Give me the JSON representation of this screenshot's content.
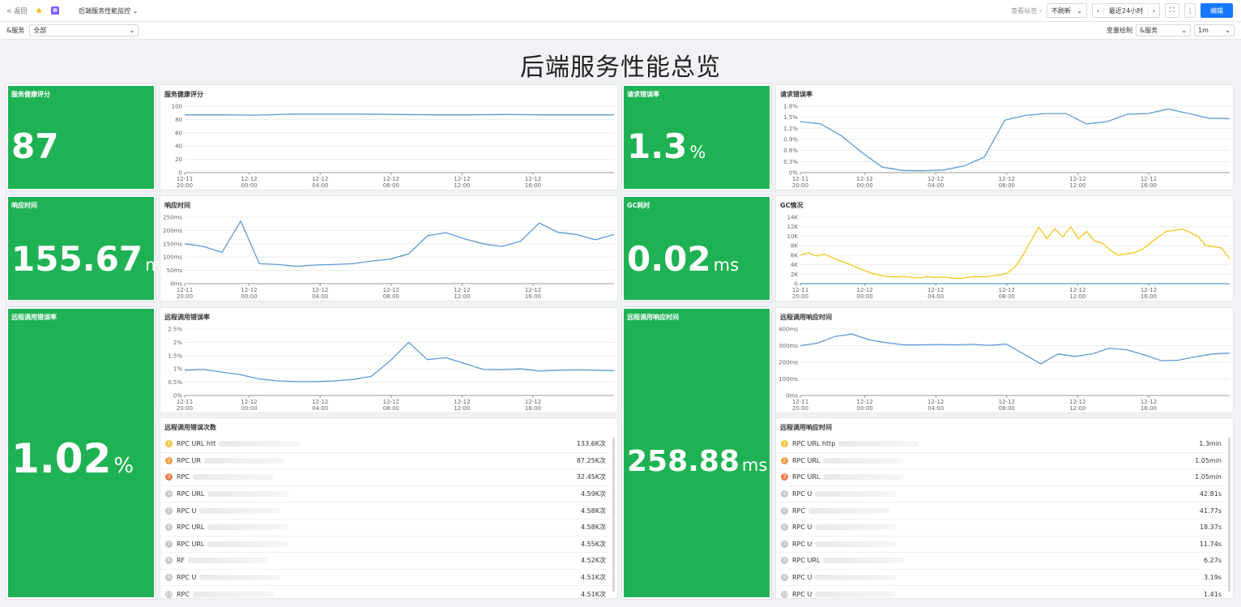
{
  "topbar": {
    "back": "< 返回",
    "title": "后端服务性能监控",
    "view_label": "查看标签",
    "refresh": "不刷新",
    "time_range": "最近24小时",
    "edit": "编辑"
  },
  "filter": {
    "service_label": "&服务",
    "service_value": "全部",
    "var_label": "变量绘制",
    "var_value": "&服务",
    "interval": "1m"
  },
  "dashboard_title": "后端服务性能总览",
  "x_ticks": [
    {
      "d": "12-11",
      "t": "20:00"
    },
    {
      "d": "12-12",
      "t": "00:00"
    },
    {
      "d": "12-12",
      "t": "04:00"
    },
    {
      "d": "12-12",
      "t": "08:00"
    },
    {
      "d": "12-12",
      "t": "12:00"
    },
    {
      "d": "12-12",
      "t": "16:00"
    }
  ],
  "stats": {
    "health": {
      "title": "服务健康评分",
      "value": "87",
      "unit": ""
    },
    "error_rate": {
      "title": "请求错误率",
      "value": "1.3",
      "unit": "%"
    },
    "resp_time": {
      "title": "响应时间",
      "value": "155.67",
      "unit": "ms"
    },
    "gc": {
      "title": "GC耗时",
      "value": "0.02",
      "unit": "ms"
    },
    "remote_err": {
      "title": "远程调用错误率",
      "value": "1.02",
      "unit": "%"
    },
    "remote_resp": {
      "title": "远程调用响应时间",
      "value": "258.88",
      "unit": "ms"
    }
  },
  "icons": {
    "back": "back-arrow-icon",
    "star": "star-icon",
    "app": "app-icon",
    "chevron": "chevron-down-icon",
    "prev": "chevron-left-icon",
    "next": "chevron-right-icon",
    "fullscreen": "fullscreen-icon",
    "more": "more-icon"
  },
  "colors": {
    "stat_bg": "#1fb254",
    "line_blue": "#5b9bd5",
    "line_yellow": "#f5c518",
    "primary": "#1677ff"
  },
  "chart_data": [
    {
      "id": "health",
      "type": "line",
      "title": "服务健康评分",
      "yticks": [
        "100",
        "80",
        "60",
        "40",
        "20",
        "0"
      ],
      "ylim": [
        0,
        100
      ],
      "color": "#5b9bd5",
      "values": [
        87,
        87,
        86.5,
        88,
        88,
        88,
        87.5,
        87,
        87,
        87.5,
        87,
        87,
        87
      ]
    },
    {
      "id": "error_rate",
      "type": "line",
      "title": "请求错误率",
      "yticks": [
        "1.8%",
        "1.5%",
        "1.2%",
        "0.9%",
        "0.6%",
        "0.3%",
        "0%"
      ],
      "ylim": [
        0,
        1.8
      ],
      "color": "#5b9bd5",
      "values": [
        1.38,
        1.32,
        1.0,
        0.55,
        0.15,
        0.06,
        0.05,
        0.07,
        0.18,
        0.42,
        1.42,
        1.55,
        1.6,
        1.6,
        1.32,
        1.38,
        1.58,
        1.6,
        1.72,
        1.6,
        1.47,
        1.46
      ]
    },
    {
      "id": "resp_time",
      "type": "line",
      "title": "响应时间",
      "yticks": [
        "250ms",
        "200ms",
        "150ms",
        "100ms",
        "50ms",
        "0ms"
      ],
      "ylim": [
        0,
        250
      ],
      "color": "#5b9bd5",
      "values": [
        150,
        140,
        118,
        235,
        75,
        72,
        65,
        70,
        72,
        75,
        85,
        92,
        112,
        180,
        192,
        168,
        150,
        140,
        160,
        228,
        193,
        185,
        165,
        185
      ]
    },
    {
      "id": "gc",
      "type": "line",
      "title": "GC情况",
      "yticks": [
        "14K",
        "12K",
        "10K",
        "8K",
        "6K",
        "4K",
        "2K",
        "0"
      ],
      "ylim": [
        0,
        14000
      ],
      "series": [
        {
          "color": "#f5c518",
          "values": [
            6000,
            6500,
            5800,
            6200,
            5500,
            4800,
            4200,
            3500,
            2800,
            2200,
            1800,
            1500,
            1400,
            1600,
            1300,
            1200,
            1500,
            1300,
            1400,
            1200,
            1100,
            1300,
            1500,
            1400,
            1600,
            1800,
            2200,
            3500,
            6000,
            9000,
            11900,
            9500,
            11600,
            9800,
            12000,
            9400,
            11000,
            9000,
            8500,
            7000,
            6000,
            6300,
            6500,
            7200,
            8500,
            9800,
            11000,
            11200,
            11500,
            10800,
            10000,
            8000,
            7800,
            7500,
            5200
          ]
        },
        {
          "color": "#5b9bd5",
          "values": [
            0,
            0,
            0,
            0,
            0,
            0,
            0,
            0,
            0,
            0,
            0,
            0,
            0
          ]
        }
      ]
    },
    {
      "id": "remote_err",
      "type": "line",
      "title": "远程调用错误率",
      "yticks": [
        "2.5%",
        "2%",
        "1.5%",
        "1%",
        "0.5%",
        "0%"
      ],
      "ylim": [
        0,
        2.5
      ],
      "color": "#5b9bd5",
      "values": [
        0.95,
        0.98,
        0.88,
        0.78,
        0.62,
        0.55,
        0.52,
        0.52,
        0.55,
        0.6,
        0.72,
        1.3,
        2.0,
        1.35,
        1.42,
        1.2,
        0.98,
        0.97,
        1.0,
        0.92,
        0.95,
        0.96,
        0.95,
        0.93
      ]
    },
    {
      "id": "remote_resp",
      "type": "line",
      "title": "远程调用响应时间",
      "yticks": [
        "400ms",
        "300ms",
        "200ms",
        "100ms",
        "0ms"
      ],
      "ylim": [
        0,
        400
      ],
      "color": "#5b9bd5",
      "values": [
        300,
        315,
        355,
        370,
        335,
        318,
        305,
        305,
        307,
        305,
        308,
        302,
        310,
        250,
        190,
        250,
        235,
        250,
        285,
        275,
        245,
        210,
        212,
        232,
        250,
        255
      ]
    }
  ],
  "remote_err_top": {
    "title": "远程调用错误次数",
    "rows": [
      {
        "rank": "1",
        "label": "RPC URL htt",
        "value": "133.6K次"
      },
      {
        "rank": "2",
        "label": "RPC UR",
        "value": "87.25K次"
      },
      {
        "rank": "3",
        "label": "RPC",
        "value": "32.45K次"
      },
      {
        "rank": "4",
        "label": "RPC URL",
        "value": "4.59K次"
      },
      {
        "rank": "5",
        "label": "RPC U",
        "value": "4.58K次"
      },
      {
        "rank": "6",
        "label": "RPC URL",
        "value": "4.58K次"
      },
      {
        "rank": "7",
        "label": "RPC URL",
        "value": "4.55K次"
      },
      {
        "rank": "8",
        "label": "RF",
        "value": "4.52K次"
      },
      {
        "rank": "9",
        "label": "RPC U",
        "value": "4.51K次"
      },
      {
        "rank": "10",
        "label": "RPC",
        "value": "4.51K次"
      }
    ]
  },
  "remote_resp_top": {
    "title": "远程调用响应时间",
    "rows": [
      {
        "rank": "1",
        "label": "RPC URL http",
        "value": "1.3min"
      },
      {
        "rank": "2",
        "label": "RPC URL",
        "value": "1.05min"
      },
      {
        "rank": "3",
        "label": "RPC URL",
        "value": "1.05min"
      },
      {
        "rank": "4",
        "label": "RPC U",
        "value": "42.81s"
      },
      {
        "rank": "5",
        "label": "RPC",
        "value": "41.77s"
      },
      {
        "rank": "6",
        "label": "RPC U",
        "value": "18.37s"
      },
      {
        "rank": "7",
        "label": "RPC U",
        "value": "11.74s"
      },
      {
        "rank": "8",
        "label": "RPC URL",
        "value": "6.27s"
      },
      {
        "rank": "9",
        "label": "RPC U",
        "value": "3.19s"
      },
      {
        "rank": "10",
        "label": "RPC U",
        "value": "1.41s"
      }
    ]
  }
}
